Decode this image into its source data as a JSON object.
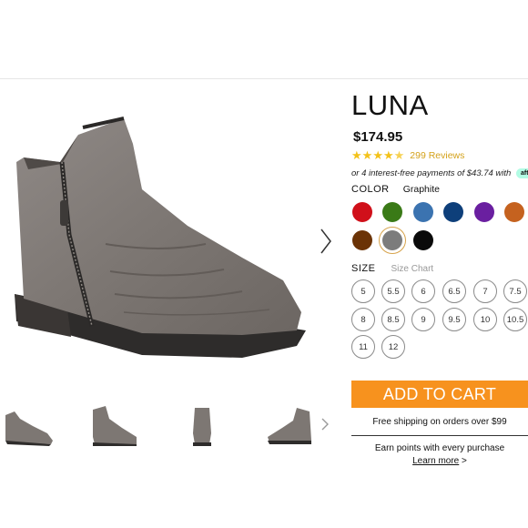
{
  "product": {
    "title": "LUNA",
    "price": "$174.95",
    "rating_stars": 4.5,
    "reviews_label": "299 Reviews",
    "installments_text": "or 4 interest-free payments of $43.74 with",
    "afterpay_label": "afterpay"
  },
  "color": {
    "label": "COLOR",
    "selected": "Graphite",
    "swatches": [
      {
        "name": "red",
        "hex": "#d0101a"
      },
      {
        "name": "green",
        "hex": "#3a7a17"
      },
      {
        "name": "blue",
        "hex": "#3b73b0"
      },
      {
        "name": "navy",
        "hex": "#0e3f7a"
      },
      {
        "name": "purple",
        "hex": "#6a1fa0"
      },
      {
        "name": "orange",
        "hex": "#c5621f"
      },
      {
        "name": "brown",
        "hex": "#6b3306"
      },
      {
        "name": "graphite",
        "hex": "#7c7c7c"
      },
      {
        "name": "black",
        "hex": "#0a0a0a"
      }
    ]
  },
  "size": {
    "label": "SIZE",
    "chart_label": "Size Chart",
    "options": [
      "5",
      "5.5",
      "6",
      "6.5",
      "7",
      "7.5",
      "8",
      "8.5",
      "9",
      "9.5",
      "10",
      "10.5",
      "11",
      "12"
    ]
  },
  "cart": {
    "add_label": "ADD TO CART",
    "shipping_text": "Free shipping on orders over $99",
    "points_text": "Earn points with every purchase",
    "learn_more_label": "Learn more",
    "learn_more_suffix": " >"
  },
  "icons": {
    "next": "chevron-right-icon",
    "thumb_next": "chevron-right-icon"
  }
}
